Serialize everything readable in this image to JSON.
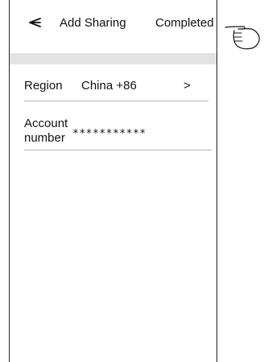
{
  "header": {
    "back_icon": "back-arrow-icon",
    "title": "Add Sharing",
    "action_label": "Completed"
  },
  "form": {
    "region": {
      "label": "Region",
      "value": "China +86",
      "chevron": ">"
    },
    "account": {
      "label": "Account number",
      "value": "***********"
    }
  },
  "annotation": {
    "pointer_icon": "pointing-hand-icon"
  },
  "colors": {
    "band": "#e3e3e3",
    "divider": "#b5b5b5",
    "text": "#111111"
  }
}
